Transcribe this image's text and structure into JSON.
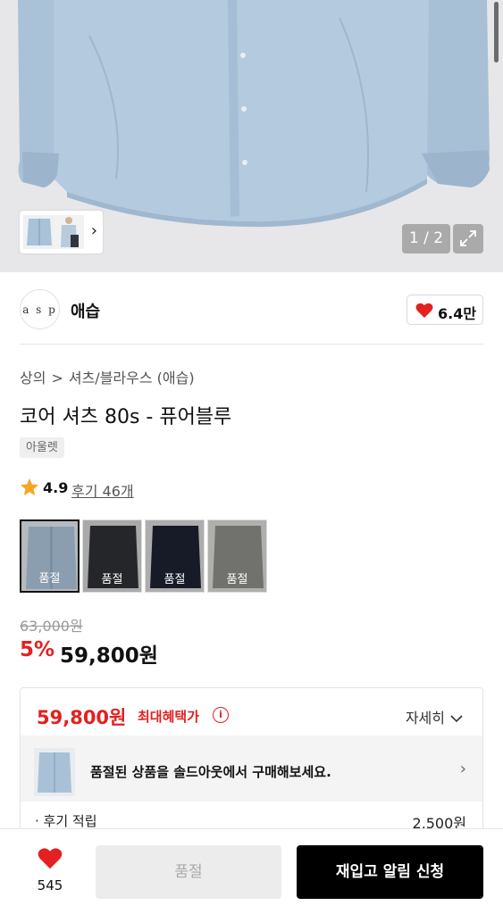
{
  "gallery": {
    "counter": "1 / 2",
    "thumb_next_icon": "chevron-right-icon",
    "expand_icon": "expand-icon"
  },
  "brand": {
    "logo_text": "a s p",
    "name": "애습",
    "like_count": "6.4만",
    "like_icon": "heart-icon",
    "heart_color": "#e42020"
  },
  "breadcrumb": [
    "상의",
    "셔츠/블라우스 (애습)"
  ],
  "product": {
    "title": "코어 셔츠 80s - 퓨어블루",
    "tag": "아울렛",
    "rating": "4.9",
    "reviews": "후기 46개"
  },
  "options": [
    {
      "label": "품절",
      "color": "#a9c1d6",
      "selected": true
    },
    {
      "label": "품절",
      "color": "#2c2f33",
      "selected": false
    },
    {
      "label": "품절",
      "color": "#1d2230",
      "selected": false
    },
    {
      "label": "품절",
      "color": "#8a8a85",
      "selected": false
    }
  ],
  "price": {
    "original": "63,000원",
    "discount": "5%",
    "sale": "59,800원",
    "accent": "#e42020"
  },
  "benefit": {
    "price": "59,800원",
    "label": "최대혜택가",
    "info_icon": "info-icon",
    "detail": "자세히",
    "soldout_message": "품절된 상품을 솔드아웃에서 구매해보세요.",
    "review_points_label": "· 후기 적립",
    "review_points_value": "2,500원"
  },
  "bottom_bar": {
    "like_count": "545",
    "sold_out": "품절",
    "notify": "재입고 알림 신청"
  }
}
